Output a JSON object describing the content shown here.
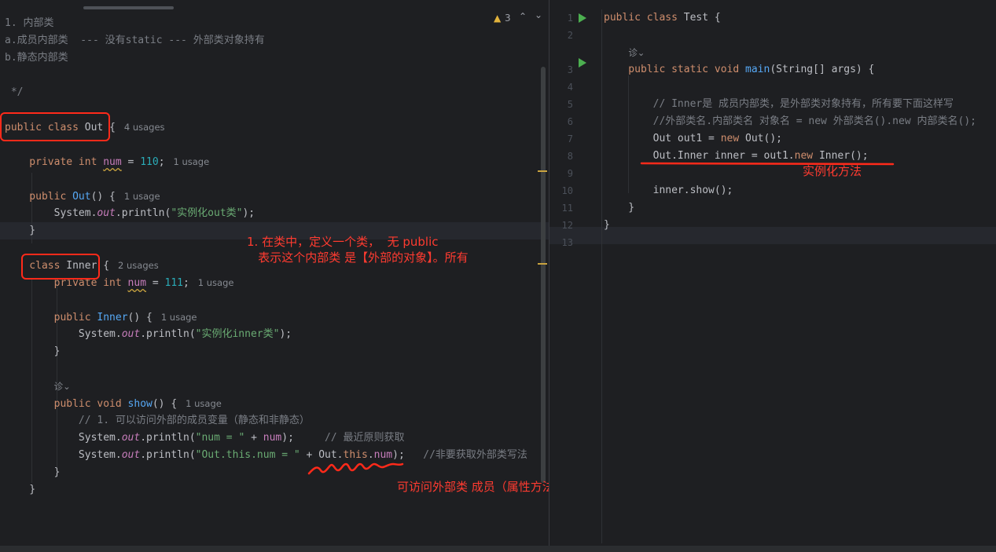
{
  "left_editor": {
    "inspection": {
      "count": "3",
      "up": "⌃",
      "down": "⌄"
    },
    "lines": [
      [
        {
          "t": "1. 内部类",
          "c": "cm"
        }
      ],
      [
        {
          "t": "a.成员内部类  --- 没有static --- 外部类对象持有",
          "c": "cm"
        }
      ],
      [
        {
          "t": "b.静态内部类",
          "c": "cm"
        }
      ],
      [],
      [
        {
          "t": " */",
          "c": "cm"
        }
      ],
      [],
      [
        {
          "t": "public class ",
          "c": "kw"
        },
        {
          "t": "Out ",
          "c": "plain"
        },
        {
          "t": "{",
          "c": "plain"
        },
        {
          "t": "   4 usages",
          "c": "hint"
        }
      ],
      [],
      [
        {
          "t": "    private int ",
          "c": "kw"
        },
        {
          "t": "num",
          "c": "field warnu"
        },
        {
          "t": " = ",
          "c": "plain"
        },
        {
          "t": "110",
          "c": "num"
        },
        {
          "t": ";",
          "c": "plain"
        },
        {
          "t": "   1 usage",
          "c": "hint"
        }
      ],
      [],
      [
        {
          "t": "    public ",
          "c": "kw"
        },
        {
          "t": "Out",
          "c": "fn"
        },
        {
          "t": "() {",
          "c": "plain"
        },
        {
          "t": "   1 usage",
          "c": "hint"
        }
      ],
      [
        {
          "t": "        System.",
          "c": "plain"
        },
        {
          "t": "out",
          "c": "static"
        },
        {
          "t": ".println(",
          "c": "plain"
        },
        {
          "t": "\"实例化out类\"",
          "c": "str"
        },
        {
          "t": ");",
          "c": "plain"
        }
      ],
      [
        {
          "t": "    }",
          "c": "plain"
        }
      ],
      [],
      [
        {
          "t": "    class ",
          "c": "kw"
        },
        {
          "t": "Inner ",
          "c": "plain"
        },
        {
          "t": "{",
          "c": "plain"
        },
        {
          "t": "   2 usages",
          "c": "hint"
        }
      ],
      [
        {
          "t": "        private int ",
          "c": "kw"
        },
        {
          "t": "num",
          "c": "field warnu"
        },
        {
          "t": " = ",
          "c": "plain"
        },
        {
          "t": "111",
          "c": "num"
        },
        {
          "t": ";",
          "c": "plain"
        },
        {
          "t": "   1 usage",
          "c": "hint"
        }
      ],
      [],
      [
        {
          "t": "        public ",
          "c": "kw"
        },
        {
          "t": "Inner",
          "c": "fn"
        },
        {
          "t": "() {",
          "c": "plain"
        },
        {
          "t": "   1 usage",
          "c": "hint"
        }
      ],
      [
        {
          "t": "            System.",
          "c": "plain"
        },
        {
          "t": "out",
          "c": "static"
        },
        {
          "t": ".println(",
          "c": "plain"
        },
        {
          "t": "\"实例化inner类\"",
          "c": "str"
        },
        {
          "t": ");",
          "c": "plain"
        }
      ],
      [
        {
          "t": "        }",
          "c": "plain"
        }
      ],
      [],
      [
        {
          "t": "        ",
          "c": "plain"
        },
        {
          "t": "诊⌄",
          "c": "hint"
        }
      ],
      [
        {
          "t": "        public void ",
          "c": "kw"
        },
        {
          "t": "show",
          "c": "fn"
        },
        {
          "t": "() {",
          "c": "plain"
        },
        {
          "t": "   1 usage",
          "c": "hint"
        }
      ],
      [
        {
          "t": "            // 1. 可以访问外部的成员变量（静态和非静态）",
          "c": "cm"
        }
      ],
      [
        {
          "t": "            System.",
          "c": "plain"
        },
        {
          "t": "out",
          "c": "static"
        },
        {
          "t": ".println(",
          "c": "plain"
        },
        {
          "t": "\"num = \"",
          "c": "str"
        },
        {
          "t": " + ",
          "c": "plain"
        },
        {
          "t": "num",
          "c": "field"
        },
        {
          "t": ");     ",
          "c": "plain"
        },
        {
          "t": "// 最近原则获取",
          "c": "cm"
        }
      ],
      [
        {
          "t": "            System.",
          "c": "plain"
        },
        {
          "t": "out",
          "c": "static"
        },
        {
          "t": ".println(",
          "c": "plain"
        },
        {
          "t": "\"Out.this.num = \"",
          "c": "str"
        },
        {
          "t": " + Out.",
          "c": "plain"
        },
        {
          "t": "this",
          "c": "kw"
        },
        {
          "t": ".",
          "c": "plain"
        },
        {
          "t": "num",
          "c": "field"
        },
        {
          "t": ");   ",
          "c": "plain"
        },
        {
          "t": "//非要获取外部类写法",
          "c": "cm"
        }
      ],
      [
        {
          "t": "        }",
          "c": "plain"
        }
      ],
      [
        {
          "t": "    }",
          "c": "plain"
        }
      ],
      [],
      [],
      [],
      [
        {
          "t": "}",
          "c": "plain"
        }
      ]
    ]
  },
  "right_editor": {
    "line_numbers": [
      "1",
      "2",
      "",
      "3",
      "4",
      "5",
      "6",
      "7",
      "8",
      "9",
      "10",
      "11",
      "12",
      "13"
    ],
    "lines": [
      [
        {
          "t": "public class ",
          "c": "kw"
        },
        {
          "t": "Test ",
          "c": "plain"
        },
        {
          "t": "{",
          "c": "plain"
        }
      ],
      [],
      [
        {
          "t": "    ",
          "c": "plain"
        },
        {
          "t": "诊⌄",
          "c": "hint"
        }
      ],
      [
        {
          "t": "    public static void ",
          "c": "kw"
        },
        {
          "t": "main",
          "c": "fn"
        },
        {
          "t": "(String[] args) {",
          "c": "plain"
        }
      ],
      [],
      [
        {
          "t": "        // Inner是 成员内部类，是外部类对象持有，所有要下面这样写",
          "c": "cm"
        }
      ],
      [
        {
          "t": "        //外部类名.内部类名 对象名 = new 外部类名().new 内部类名();",
          "c": "cm"
        }
      ],
      [
        {
          "t": "        Out out1 = ",
          "c": "plain"
        },
        {
          "t": "new ",
          "c": "kw"
        },
        {
          "t": "Out();",
          "c": "plain"
        }
      ],
      [
        {
          "t": "        Out.Inner inner = out1.",
          "c": "plain"
        },
        {
          "t": "new ",
          "c": "kw"
        },
        {
          "t": "Inner();",
          "c": "plain"
        }
      ],
      [],
      [
        {
          "t": "        inner.show();",
          "c": "plain"
        }
      ],
      [
        {
          "t": "    }",
          "c": "plain"
        }
      ],
      [
        {
          "t": "}",
          "c": "plain"
        }
      ],
      []
    ]
  },
  "annotations": {
    "inner_class_note": "1. 在类中，定义一个类，  无 public\n   表示这个内部类 是【外部的对象】。所有",
    "outer_access_note": "可访问外部类 成员（属性方法）",
    "instantiation_note": "实例化方法"
  },
  "colors": {
    "annotation_red": "#ff2a1a",
    "run_icon": "#4caf50"
  }
}
